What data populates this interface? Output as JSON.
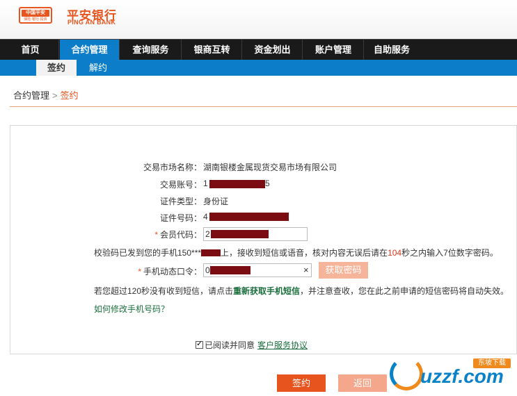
{
  "header": {
    "logo_badge": "中国平安",
    "logo_badge_sub": "保险·银行·投资",
    "bank_name": "平安银行",
    "bank_name_en": "PING AN BANK"
  },
  "nav": {
    "items": [
      {
        "label": "首页"
      },
      {
        "label": "合约管理"
      },
      {
        "label": "查询服务"
      },
      {
        "label": "银商互转"
      },
      {
        "label": "资金划出"
      },
      {
        "label": "账户管理"
      },
      {
        "label": "自助服务"
      }
    ],
    "active_index": 1
  },
  "subnav": {
    "items": [
      {
        "label": "签约"
      },
      {
        "label": "解约"
      }
    ],
    "active_index": 0
  },
  "breadcrumb": {
    "parent": "合约管理",
    "separator": ">",
    "current": "签约"
  },
  "form": {
    "market_name_label": "交易市场名称：",
    "market_name_value": "湖南银楼金属现货交易市场有限公司",
    "account_label": "交易账号：",
    "account_prefix": "1",
    "account_suffix": "5",
    "id_type_label": "证件类型：",
    "id_type_value": "身份证",
    "id_number_label": "证件号码：",
    "id_number_prefix": "4",
    "member_code_label": "会员代码：",
    "member_code_prefix": "2",
    "required_mark": "*",
    "sms_notice_before": "校验码已发到您的手机150***",
    "sms_notice_middle": "上，接收到短信或语音，核对内容无误后请在",
    "sms_countdown": "104",
    "sms_notice_after": "秒之内输入7位数字密码。",
    "otp_label": "手机动态口令：",
    "otp_prefix": "0",
    "otp_clear": "×",
    "get_password_button": "获取密码",
    "resend_before": "若您超过120秒没有收到短信，请点击",
    "resend_link": "重新获取手机短信",
    "resend_after": "，并注意查收，您在此之前申请的短信密码将自动失效。",
    "change_phone_link": "如何修改手机号码？",
    "agree_text": "已阅读并同意",
    "agree_link": "客户服务协议",
    "agree_checked": true
  },
  "actions": {
    "sign_button": "签约",
    "back_button": "返回"
  },
  "watermark": {
    "brand": "uzzf.com",
    "tag": "东坡下载"
  },
  "colors": {
    "brand_orange": "#e8541e",
    "nav_dark": "#1a1a1a",
    "nav_active_blue": "#0c7dc8",
    "redaction": "#7a0c12",
    "link_green": "#1a6e3c",
    "countdown_red": "#d9361c"
  }
}
